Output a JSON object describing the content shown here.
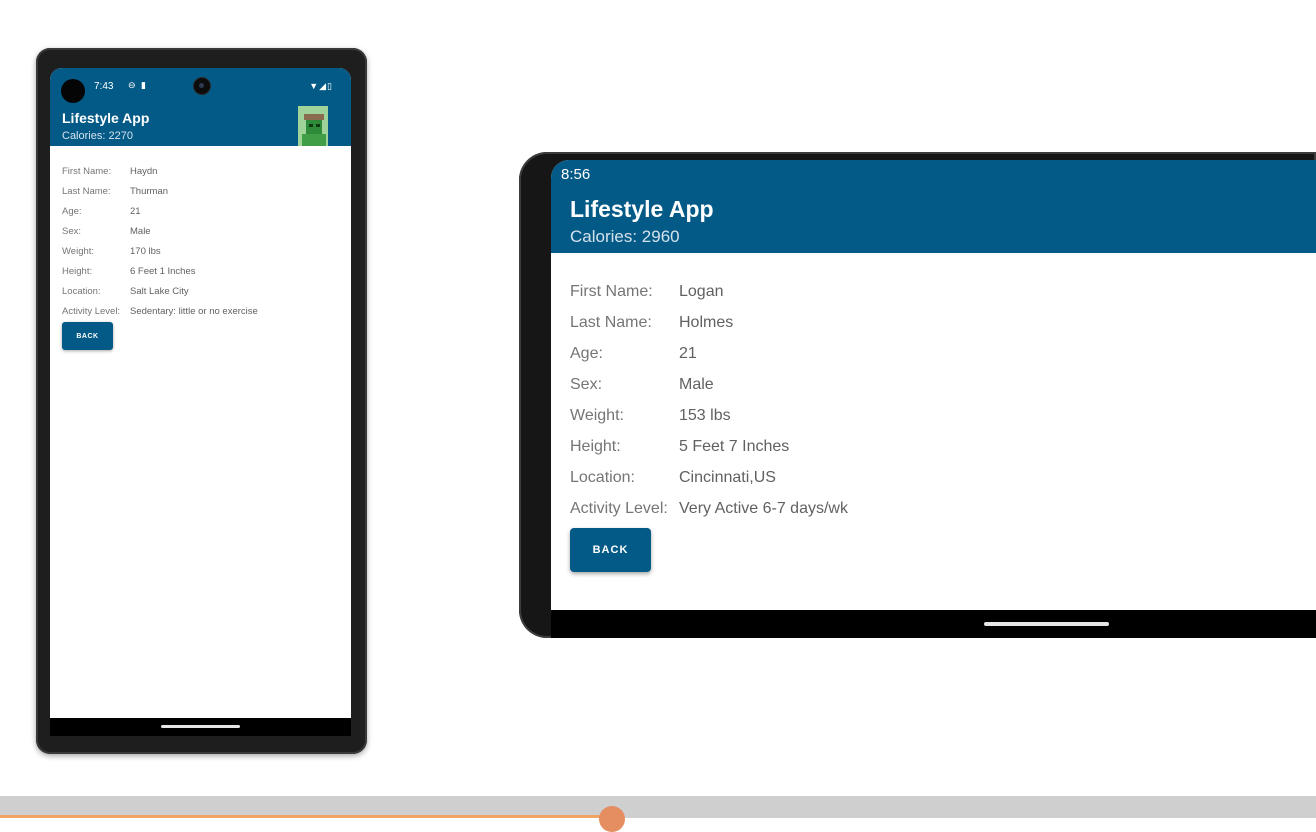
{
  "portrait": {
    "status": {
      "time": "7:43",
      "icons": [
        "dnd-icon",
        "sim-icon"
      ],
      "right_icons": [
        "wifi-icon",
        "signal-icon",
        "battery-icon"
      ]
    },
    "header": {
      "title": "Lifestyle App",
      "calories": "Calories: 2270"
    },
    "profile": [
      {
        "label": "First Name:",
        "value": "Haydn"
      },
      {
        "label": "Last Name:",
        "value": "Thurman"
      },
      {
        "label": "Age:",
        "value": "21"
      },
      {
        "label": "Sex:",
        "value": "Male"
      },
      {
        "label": "Weight:",
        "value": "170  lbs"
      },
      {
        "label": "Height:",
        "value": "6  Feet  1  Inches"
      },
      {
        "label": "Location:",
        "value": "Salt Lake City"
      },
      {
        "label": "Activity Level:",
        "value": "Sedentary: little or no exercise"
      }
    ],
    "back_label": "BACK"
  },
  "landscape": {
    "status": {
      "time": "8:56"
    },
    "header": {
      "title": "Lifestyle App",
      "calories": "Calories: 2960"
    },
    "profile": [
      {
        "label": "First Name:",
        "value": "Logan"
      },
      {
        "label": "Last Name:",
        "value": "Holmes"
      },
      {
        "label": "Age:",
        "value": "21"
      },
      {
        "label": "Sex:",
        "value": "Male"
      },
      {
        "label": "Weight:",
        "value": "153  lbs"
      },
      {
        "label": "Height:",
        "value": "5  Feet  7  Inches"
      },
      {
        "label": "Location:",
        "value": "Cincinnati,US"
      },
      {
        "label": "Activity Level:",
        "value": "Very Active 6-7 days/wk"
      }
    ],
    "back_label": "BACK"
  },
  "colors": {
    "app_bar": "#045a87",
    "progress": "#f0a564",
    "knob": "#e48e61"
  },
  "player": {
    "progress_fraction": 0.465
  }
}
